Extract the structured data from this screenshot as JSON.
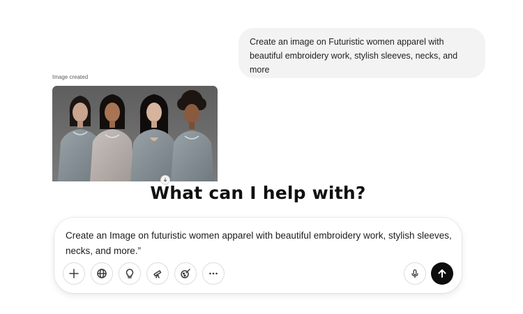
{
  "conversation": {
    "user_message": "Create an image on Futuristic women apparel with beautiful embroidery work, stylish sleeves, necks, and more",
    "image_caption": "Image created",
    "image_description_icon": "generated-image"
  },
  "main": {
    "heading": "What can I help with?"
  },
  "composer": {
    "input_value": "Create an Image on futuristic women apparel with beautiful embroidery work, stylish sleeves, necks, and more.”",
    "tools": [
      "plus-icon",
      "globe-icon",
      "lightbulb-icon",
      "telescope-icon",
      "paintbrush-icon",
      "more-icon"
    ],
    "mic_icon": "microphone-icon",
    "send_icon": "arrow-up-icon"
  },
  "colors": {
    "bubble_bg": "#f3f3f3",
    "send_bg": "#0d0d0d",
    "text": "#0d0d0d"
  }
}
